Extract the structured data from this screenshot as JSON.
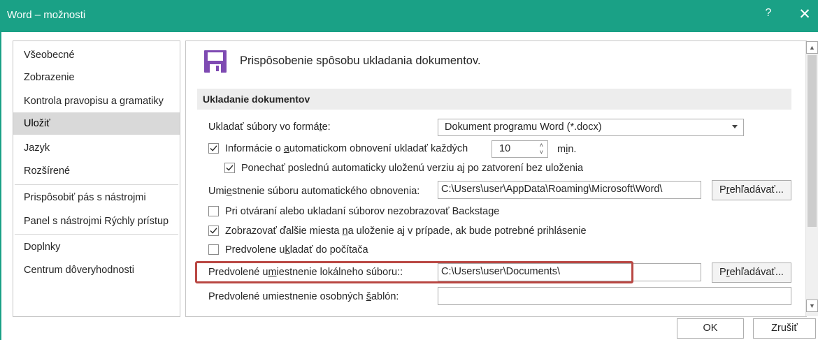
{
  "window": {
    "title": "Word – možnosti",
    "help_glyph": "?",
    "close_glyph": "✕"
  },
  "sidebar": {
    "items": [
      {
        "label": "Všeobecné"
      },
      {
        "label": "Zobrazenie"
      },
      {
        "label": "Kontrola pravopisu a gramatiky"
      },
      {
        "label": "Uložiť",
        "selected": true
      },
      {
        "label": "Jazyk"
      },
      {
        "label": "Rozšírené"
      },
      {
        "label": "Prispôsobiť pás s nástrojmi"
      },
      {
        "label": "Panel s nástrojmi Rýchly prístup"
      },
      {
        "label": "Doplnky"
      },
      {
        "label": "Centrum dôveryhodnosti"
      }
    ]
  },
  "main": {
    "heading": "Prispôsobenie spôsobu ukladania dokumentov.",
    "section_title": "Ukladanie dokumentov",
    "save_format": {
      "label_pre": "Ukladať súbory vo formá",
      "label_hotkey": "t",
      "label_post": "e:",
      "value": "Dokument programu Word (*.docx)"
    },
    "autorecover": {
      "checked": true,
      "label_pre": "Informácie o ",
      "label_hotkey": "a",
      "label_post": "utomatickom obnovení ukladať každých",
      "minutes": "10",
      "unit_pre": "m",
      "unit_hotkey": "i",
      "unit_post": "n."
    },
    "keep_last": {
      "checked": true,
      "label": "Ponechať poslednú automaticky uloženú verziu aj po zatvorení bez uloženia"
    },
    "autorecover_location": {
      "label_pre": "Umi",
      "label_hotkey": "e",
      "label_post": "stnenie súboru automatického obnovenia:",
      "value": "C:\\Users\\user\\AppData\\Roaming\\Microsoft\\Word\\",
      "browse_pre": "P",
      "browse_hotkey": "r",
      "browse_post": "ehľadávať..."
    },
    "no_backstage": {
      "checked": false,
      "label": "Pri otváraní alebo ukladaní súborov nezobrazovať Backstage"
    },
    "show_more_places": {
      "checked": true,
      "label_pre": "Zobrazovať ďalšie miesta ",
      "label_hotkey": "n",
      "label_post": "a uloženie aj v prípade, ak bude potrebné prihlásenie"
    },
    "save_to_computer": {
      "checked": false,
      "label_pre": "Predvolene u",
      "label_hotkey": "k",
      "label_post": "ladať do počítača"
    },
    "default_local_location": {
      "label_pre": "Predvolené u",
      "label_hotkey": "m",
      "label_post": "iestnenie lokálneho súboru::",
      "value": "C:\\Users\\user\\Documents\\",
      "browse_pre": "P",
      "browse_hotkey": "r",
      "browse_post": "ehľadávať..."
    },
    "personal_templates": {
      "label_pre": "Predvolené umiestnenie osobných ",
      "label_hotkey": "š",
      "label_post": "ablón:",
      "value": ""
    }
  },
  "footer": {
    "ok_label": "OK",
    "cancel_label": "Zrušiť"
  },
  "colors": {
    "titlebar": "#1aa186",
    "highlight_box": "#b94743",
    "save_icon": "#7e4ab2"
  },
  "icons": {
    "heading": "floppy-disk-icon"
  }
}
